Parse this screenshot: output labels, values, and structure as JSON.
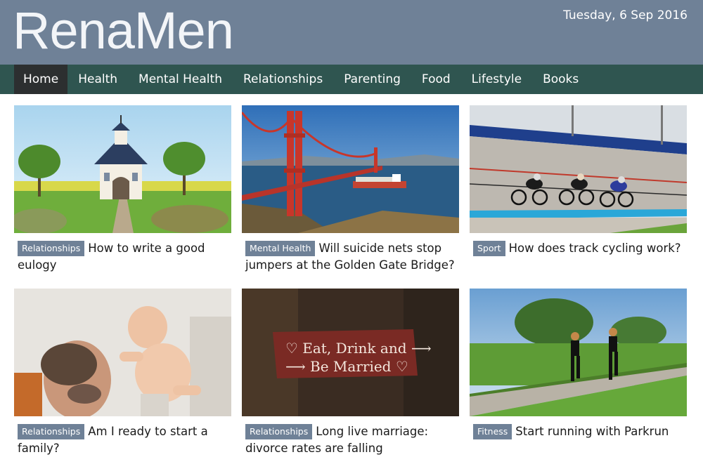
{
  "site": {
    "logo": "RenaMen",
    "date": "Tuesday, 6 Sep 2016"
  },
  "nav": [
    {
      "label": "Home",
      "active": true
    },
    {
      "label": "Health"
    },
    {
      "label": "Mental Health"
    },
    {
      "label": "Relationships"
    },
    {
      "label": "Parenting"
    },
    {
      "label": "Food"
    },
    {
      "label": "Lifestyle"
    },
    {
      "label": "Books"
    }
  ],
  "articles": [
    {
      "tag": "Relationships",
      "title": "How to write a good eulogy",
      "image": "chapel-with-trees"
    },
    {
      "tag": "Mental Health",
      "title": "Will suicide nets stop jumpers at the Golden Gate Bridge?",
      "image": "golden-gate-bridge"
    },
    {
      "tag": "Sport",
      "title": "How does track cycling work?",
      "image": "track-cyclists"
    },
    {
      "tag": "Relationships",
      "title": "Am I ready to start a family?",
      "image": "father-lifting-baby"
    },
    {
      "tag": "Relationships",
      "title": "Long live marriage: divorce rates are falling",
      "image": "eat-drink-be-married-sign"
    },
    {
      "tag": "Fitness",
      "title": "Start running with Parkrun",
      "image": "women-running-on-path"
    }
  ],
  "sign_text": {
    "line1": "♡ Eat, Drink and ⟶",
    "line2": "⟶ Be Married ♡"
  },
  "colors": {
    "header": "#6f8197",
    "nav": "#2f5550",
    "nav_active": "#2c2f30",
    "tag": "#6f8197"
  }
}
